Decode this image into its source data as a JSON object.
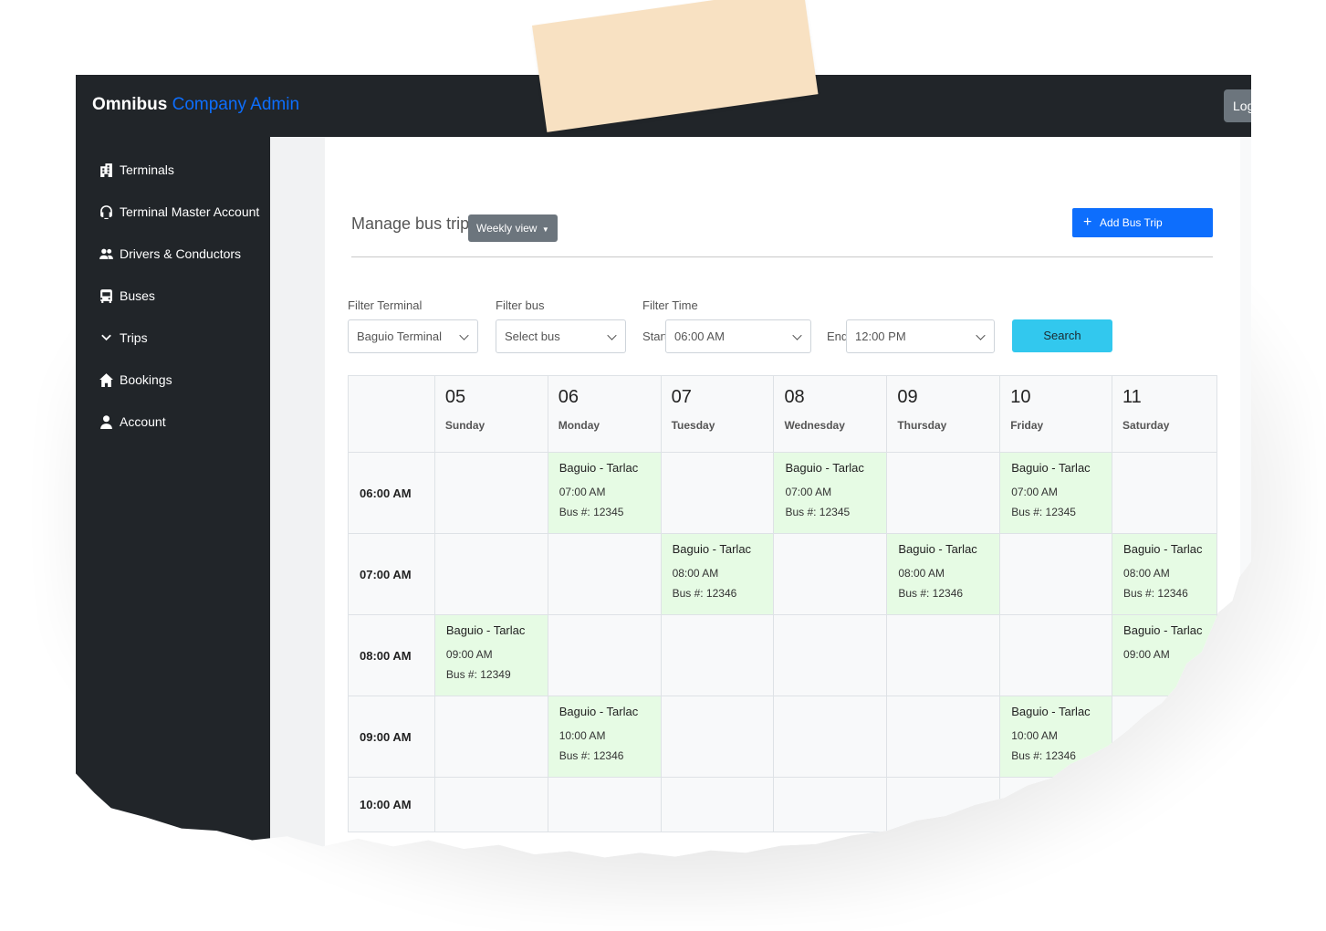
{
  "brand": {
    "name": "Omnibus",
    "sub": "Company Admin"
  },
  "topbar": {
    "logout_label": "Log"
  },
  "sidebar": {
    "items": [
      {
        "label": "Terminals",
        "icon": "building-icon"
      },
      {
        "label": "Terminal Master Account",
        "icon": "headset-icon"
      },
      {
        "label": "Drivers & Conductors",
        "icon": "people-icon"
      },
      {
        "label": "Buses",
        "icon": "bus-icon"
      },
      {
        "label": "Trips",
        "icon": "chevron-down-icon"
      },
      {
        "label": "Bookings",
        "icon": "house-icon"
      },
      {
        "label": "Account",
        "icon": "person-icon"
      }
    ]
  },
  "main": {
    "title": "Manage bus trips",
    "view_toggle": "Weekly view",
    "add_button": "Add Bus Trip"
  },
  "filters": {
    "terminal_label": "Filter Terminal",
    "terminal_value": "Baguio Terminal",
    "bus_label": "Filter bus",
    "bus_placeholder": "Select bus",
    "time_label": "Filter Time",
    "start_label": "Start",
    "start_value": "06:00 AM",
    "end_label": "End",
    "end_value": "12:00 PM",
    "search_label": "Search"
  },
  "calendar": {
    "days": [
      {
        "date": "05",
        "weekday": "Sunday"
      },
      {
        "date": "06",
        "weekday": "Monday"
      },
      {
        "date": "07",
        "weekday": "Tuesday"
      },
      {
        "date": "08",
        "weekday": "Wednesday"
      },
      {
        "date": "09",
        "weekday": "Thursday"
      },
      {
        "date": "10",
        "weekday": "Friday"
      },
      {
        "date": "11",
        "weekday": "Saturday"
      }
    ],
    "rows": [
      {
        "time": "06:00 AM",
        "trips": [
          null,
          {
            "route": "Baguio - Tarlac",
            "time": "07:00 AM",
            "bus": "Bus #: 12345"
          },
          null,
          {
            "route": "Baguio - Tarlac",
            "time": "07:00 AM",
            "bus": "Bus #: 12345"
          },
          null,
          {
            "route": "Baguio - Tarlac",
            "time": "07:00 AM",
            "bus": "Bus #: 12345"
          },
          null
        ]
      },
      {
        "time": "07:00 AM",
        "trips": [
          null,
          null,
          {
            "route": "Baguio - Tarlac",
            "time": "08:00 AM",
            "bus": "Bus #: 12346"
          },
          null,
          {
            "route": "Baguio - Tarlac",
            "time": "08:00 AM",
            "bus": "Bus #: 12346"
          },
          null,
          {
            "route": "Baguio - Tarlac",
            "time": "08:00 AM",
            "bus": "Bus #: 12346"
          }
        ]
      },
      {
        "time": "08:00 AM",
        "trips": [
          {
            "route": "Baguio - Tarlac",
            "time": "09:00 AM",
            "bus": "Bus #: 12349"
          },
          null,
          null,
          null,
          null,
          null,
          {
            "route": "Baguio - Tarlac",
            "time": "09:00 AM",
            "bus": ""
          }
        ]
      },
      {
        "time": "09:00 AM",
        "trips": [
          null,
          {
            "route": "Baguio - Tarlac",
            "time": "10:00 AM",
            "bus": "Bus #: 12346"
          },
          null,
          null,
          null,
          {
            "route": "Baguio - Tarlac",
            "time": "10:00 AM",
            "bus": "Bus #: 12346"
          },
          null
        ]
      },
      {
        "time": "10:00 AM",
        "trips": [
          null,
          null,
          null,
          null,
          null,
          null,
          null
        ]
      }
    ]
  },
  "colors": {
    "sidebar": "#212529",
    "brand_accent": "#0d6efd",
    "trip_bg": "#e6fbe4",
    "search_btn": "#32c8ee",
    "tape": "#f8e1c2"
  }
}
